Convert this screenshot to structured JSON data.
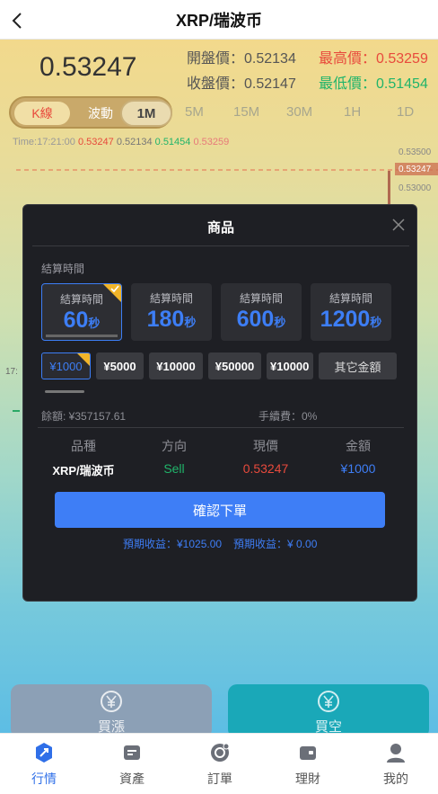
{
  "header": {
    "title": "XRP/瑞波币"
  },
  "ticker": {
    "price": "0.53247",
    "open_label": "開盤價：",
    "open_value": "0.52134",
    "close_label": "收盤價：",
    "close_value": "0.52147",
    "high_label": "最高價：",
    "high_value": "0.53259",
    "low_label": "最低價：",
    "low_value": "0.51454"
  },
  "chart_tabs": {
    "kline": "K線",
    "wave": "波動",
    "periods": [
      "1M",
      "5M",
      "15M",
      "30M",
      "1H",
      "1D"
    ],
    "selected": "1M"
  },
  "timeline": {
    "time": "Time:17:21:00",
    "v1": "0.53247",
    "v2": "0.52134",
    "v3": "0.51454",
    "v4": "0.53259"
  },
  "chart_axis": {
    "ticks": [
      "0.53500",
      "0.53247",
      "0.53000"
    ],
    "left_fragment": "17:"
  },
  "actions": {
    "buy_up": "買漲",
    "buy_down": "買空"
  },
  "modal": {
    "title": "商品",
    "section_label": "結算時間",
    "time_options": [
      {
        "label": "結算時間",
        "num": "60",
        "unit": "秒"
      },
      {
        "label": "結算時間",
        "num": "180",
        "unit": "秒"
      },
      {
        "label": "結算時間",
        "num": "600",
        "unit": "秒"
      },
      {
        "label": "結算時間",
        "num": "1200",
        "unit": "秒"
      }
    ],
    "amounts": [
      "¥1000",
      "¥5000",
      "¥10000",
      "¥50000",
      "¥10000"
    ],
    "other_amount": "其它金額",
    "balance": "餘額: ¥357157.61",
    "fee": "手續費：0%",
    "table_headers": [
      "品種",
      "方向",
      "現價",
      "金額"
    ],
    "table_row": {
      "symbol": "XRP/瑞波币",
      "direction": "Sell",
      "price": "0.53247",
      "amount": "¥1000"
    },
    "confirm": "確認下單",
    "expect1": "預期收益：¥1025.00",
    "expect2": "預期收益：¥ 0.00"
  },
  "bottom_nav": {
    "items": [
      "行情",
      "資產",
      "訂單",
      "理財",
      "我的"
    ],
    "active": "行情"
  },
  "colors": {
    "accent": "#3e7ef6",
    "up": "#20b46a",
    "down": "#e84a3c",
    "gold": "#c8a860"
  }
}
